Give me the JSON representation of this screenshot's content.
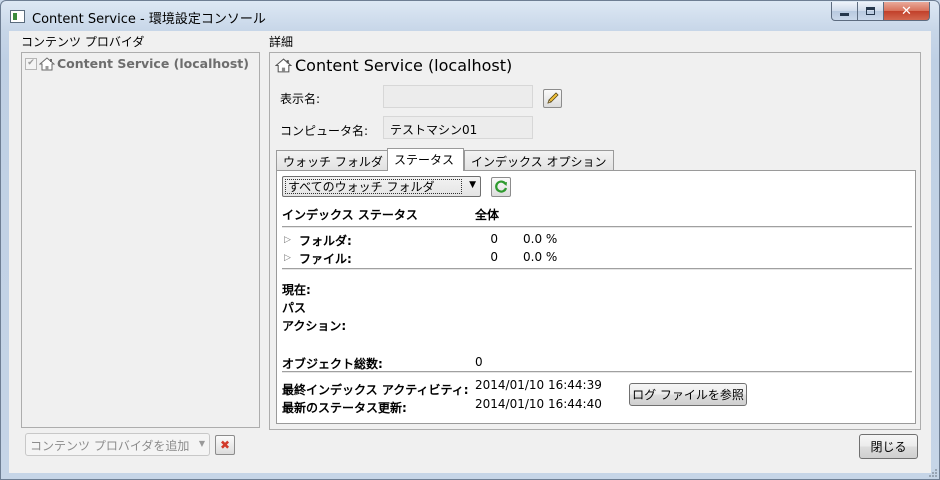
{
  "window": {
    "title": "Content Service  - 環境設定コンソール",
    "minimize_icon": "minimize-icon",
    "maximize_icon": "maximize-icon",
    "close_glyph": "✕"
  },
  "left": {
    "header": "コンテンツ プロバイダ",
    "providers": [
      {
        "label": "Content Service (localhost)",
        "checked": true,
        "icon": "home-icon"
      }
    ],
    "add_provider_label": "コンテンツ プロバイダを追加",
    "delete_glyph": "✖"
  },
  "details": {
    "header": "詳細",
    "title": "Content Service (localhost)",
    "display_name_label": "表示名:",
    "display_name_value": "",
    "computer_name_label": "コンピュータ名:",
    "computer_name_value": "テストマシン01",
    "tabs": [
      {
        "label": "ウォッチ フォルダ",
        "active": false
      },
      {
        "label": "ステータス",
        "active": true
      },
      {
        "label": "インデックス オプション",
        "active": false
      }
    ],
    "status": {
      "folder_select": "すべてのウォッチ フォルダ",
      "col_status": "インデックス ステータス",
      "col_total": "全体",
      "rows": [
        {
          "label": "フォルダ:",
          "count": "0",
          "percent": "0.0 %"
        },
        {
          "label": "ファイル:",
          "count": "0",
          "percent": "0.0 %"
        }
      ],
      "current_label": "現在:",
      "path_label": "パス",
      "action_label": "アクション:",
      "total_objects_label": "オブジェクト総数:",
      "total_objects_value": "0",
      "last_activity_label": "最終インデックス アクティビティ:",
      "last_activity_value": "2014/01/10 16:44:39",
      "last_status_label": "最新のステータス更新:",
      "last_status_value": "2014/01/10 16:44:40",
      "view_log_label": "ログ ファイルを参照"
    }
  },
  "footer": {
    "close_label": "閉じる"
  }
}
